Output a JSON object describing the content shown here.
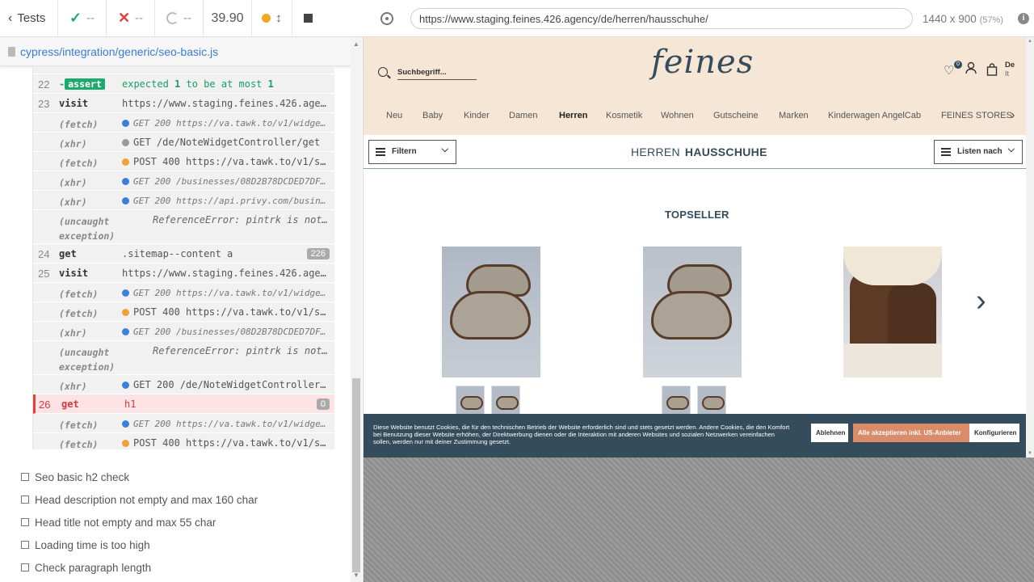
{
  "runner": {
    "back_label": "Tests",
    "passed": "--",
    "failed": "--",
    "pending": "--",
    "duration": "39.90",
    "spec_path": "cypress/integration/generic/seo-basic.js"
  },
  "commands": [
    {
      "num": "22",
      "name": "-assert",
      "message_prefix": "expected ",
      "message_val1": "1",
      "message_mid": " to be at most ",
      "message_val2": "1"
    },
    {
      "num": "23",
      "name": "visit",
      "message": "https://www.staging.feines.426.agency/de/herren/hausschuhe/"
    },
    {
      "num": "",
      "name": "(fetch)",
      "message": "GET 200 https://va.tawk.to/v1/widget-settings",
      "bullet": "blue",
      "small": true
    },
    {
      "num": "",
      "name": "(xhr)",
      "message": "GET /de/NoteWidgetController/get",
      "bullet": "gray"
    },
    {
      "num": "",
      "name": "(fetch)",
      "message": "POST 400 https://va.tawk.to/v1/session/start",
      "bullet": "orange"
    },
    {
      "num": "",
      "name": "(xhr)",
      "message": "GET 200 /businesses/08D2B78DCDED7DF97A",
      "bullet": "blue",
      "small": true
    },
    {
      "num": "",
      "name": "(xhr)",
      "message": "GET 200 https://api.privy.com/businesses",
      "bullet": "blue",
      "small": true
    },
    {
      "num": "",
      "name": "(uncaught exception)",
      "message": "ReferenceError: pintrk is not defined",
      "error": true
    },
    {
      "num": "24",
      "name": "get",
      "message": ".sitemap--content a",
      "count": "226"
    },
    {
      "num": "25",
      "name": "visit",
      "message": "https://www.staging.feines.426.agency/de/"
    },
    {
      "num": "",
      "name": "(fetch)",
      "message": "GET 200 https://va.tawk.to/v1/widget-settings",
      "bullet": "blue",
      "small": true
    },
    {
      "num": "",
      "name": "(fetch)",
      "message": "POST 400 https://va.tawk.to/v1/session/start",
      "bullet": "orange"
    },
    {
      "num": "",
      "name": "(xhr)",
      "message": "GET 200 /businesses/08D2B78DCDED7DF97A",
      "bullet": "blue",
      "small": true
    },
    {
      "num": "",
      "name": "(uncaught exception)",
      "message": "ReferenceError: pintrk is not defined",
      "error": true
    },
    {
      "num": "",
      "name": "(xhr)",
      "message": "GET 200 /de/NoteWidgetController/get",
      "bullet": "blue"
    },
    {
      "num": "26",
      "name": "get",
      "message": "h1",
      "count": "0",
      "failed": true
    },
    {
      "num": "",
      "name": "(fetch)",
      "message": "GET 200 https://va.tawk.to/v1/widget-settings",
      "bullet": "blue",
      "small": true
    },
    {
      "num": "",
      "name": "(fetch)",
      "message": "POST 400 https://va.tawk.to/v1/session/start",
      "bullet": "orange"
    }
  ],
  "tests": [
    "Seo basic h2 check",
    "Head description not empty and max 160 char",
    "Head title not empty and max 55 char",
    "Loading time is too high",
    "Check paragraph length"
  ],
  "aut": {
    "url": "https://www.staging.feines.426.agency/de/herren/hausschuhe/",
    "viewport": "1440 x 900",
    "scale": "(57%)"
  },
  "site": {
    "search_placeholder": "Suchbegriff...",
    "logo": "feines",
    "wishlist_count": "0",
    "lang_main": "De",
    "lang_sub": "It",
    "menu": [
      "Neu",
      "Baby",
      "Kinder",
      "Damen",
      "Herren",
      "Kosmetik",
      "Wohnen",
      "Gutscheine",
      "Marken",
      "Kinderwagen AngelCab",
      "FEINES STORES"
    ],
    "menu_active": "Herren",
    "filter_label": "Filtern",
    "crumb_parent": "HERREN",
    "crumb_current": "HAUSSCHUHE",
    "sort_label": "Listen nach",
    "topseller": "TOPSELLER",
    "cookie": {
      "text": "Diese Website benutzt Cookies, die für den technischen Betrieb der Website erforderlich sind und stets gesetzt werden. Andere Cookies, die den Komfort bei Benutzung dieser Website erhöhen, der Direktwerbung dienen oder die Interaktion mit anderen Websites und sozialen Netzwerken vereinfachen sollen, werden nur mit deiner Zustimmung gesetzt.",
      "decline": "Ablehnen",
      "accept": "Alle akzeptieren inkl. US-Anbieter",
      "configure": "Konfigurieren"
    }
  },
  "colors": {
    "pass": "#1fa971",
    "fail": "#e0413c",
    "brand": "#344c5c",
    "header_bg": "#f6e6d6",
    "accept_btn": "#d98b6a"
  }
}
